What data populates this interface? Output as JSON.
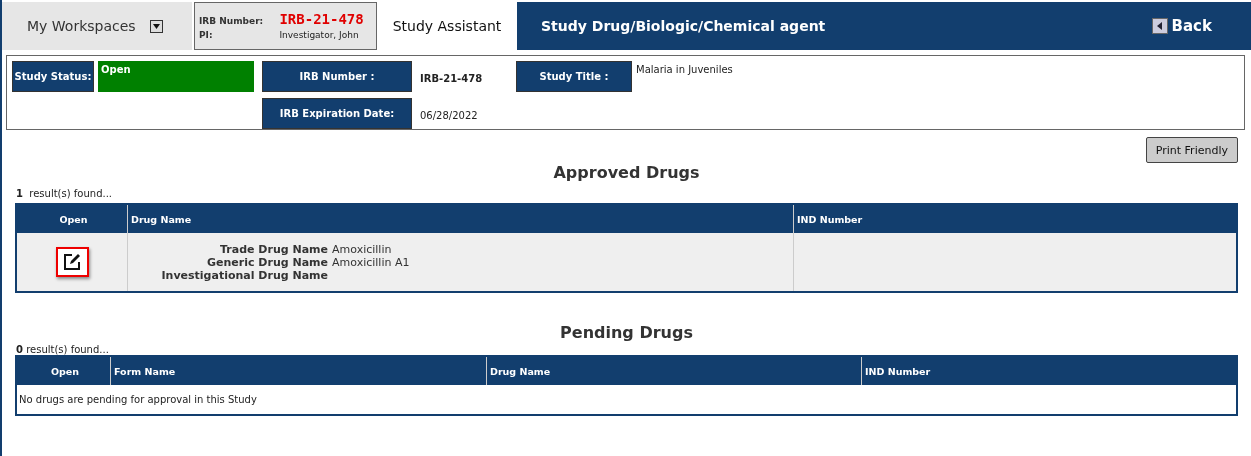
{
  "top_bar": {
    "workspaces": "My Workspaces",
    "irb_label": "IRB Number:",
    "irb_value": "IRB-21-478",
    "pi_label": "PI:",
    "pi_value": "Investigator, John",
    "tab": "Study Assistant",
    "title": "Study Drug/Biologic/Chemical agent",
    "back": "Back"
  },
  "study_info": {
    "status_label": "Study Status:",
    "status": {
      "value": "Open",
      "color": "#008000"
    },
    "irb_label": "IRB Number :",
    "irb_value": "IRB-21-478",
    "exp_label": "IRB Expiration Date:",
    "exp_value": "06/28/2022",
    "title_label": "Study Title :",
    "title_value": "Malaria in Juveniles"
  },
  "print_button": "Print Friendly",
  "approved": {
    "heading": "Approved Drugs",
    "count": "1",
    "count_text": "result(s) found...",
    "columns": [
      "Open",
      "Drug Name",
      "IND Number"
    ],
    "rows": [
      {
        "fields": [
          {
            "label": "Trade Drug Name",
            "value": "Amoxicillin"
          },
          {
            "label": "Generic Drug Name",
            "value": "Amoxicillin A1"
          },
          {
            "label": "Investigational Drug Name"
          }
        ]
      }
    ]
  },
  "pending": {
    "heading": "Pending Drugs",
    "count": "0",
    "count_text": "result(s) found...",
    "columns": [
      "Open",
      "Form Name",
      "Drug Name",
      "IND Number"
    ],
    "empty": "No drugs are pending for approval in this Study"
  }
}
